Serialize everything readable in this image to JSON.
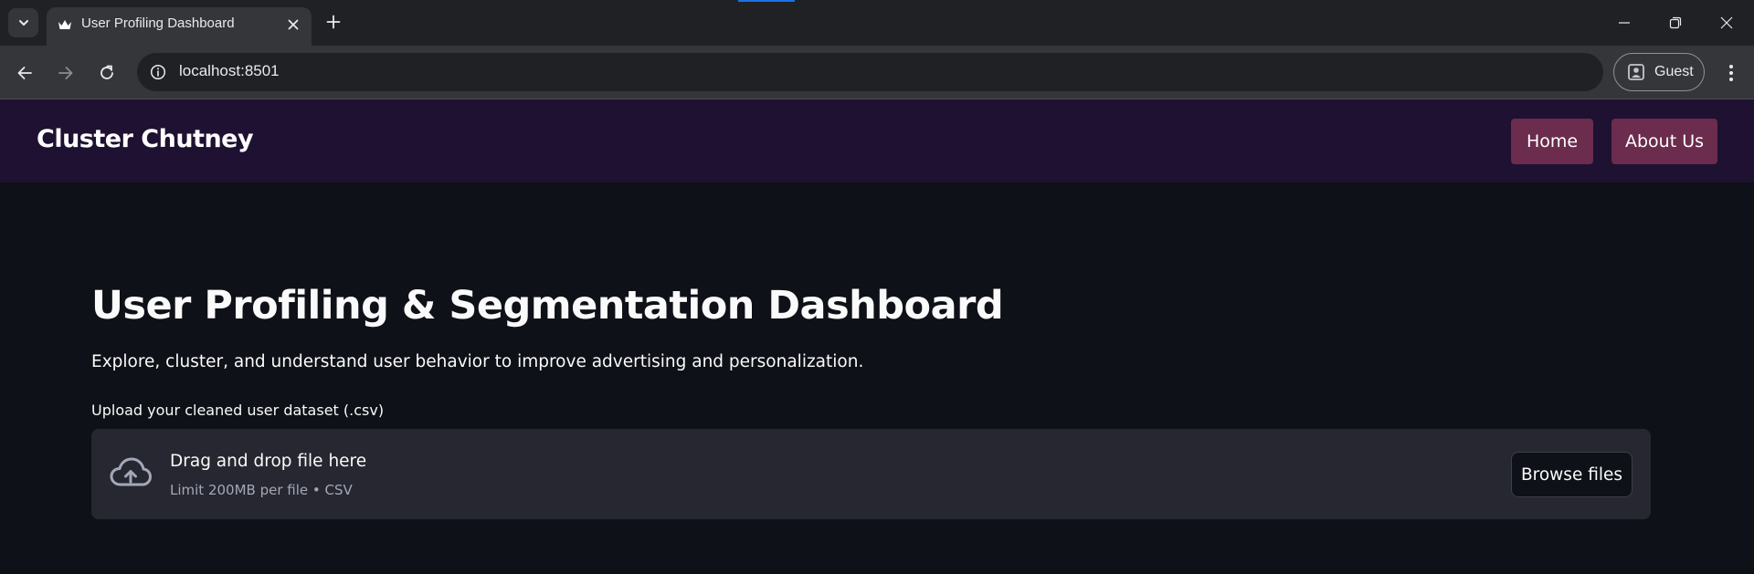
{
  "browser": {
    "tab_title": "User Profiling Dashboard",
    "url": "localhost:8501",
    "profile_label": "Guest"
  },
  "header": {
    "brand": "Cluster Chutney",
    "nav": [
      "Home",
      "About Us"
    ]
  },
  "main": {
    "title": "User Profiling & Segmentation Dashboard",
    "description": "Explore, cluster, and understand user behavior to improve advertising and personalization.",
    "upload_label": "Upload your cleaned user dataset (.csv)",
    "dropzone": {
      "title": "Drag and drop file here",
      "subtitle": "Limit 200MB per file • CSV",
      "button": "Browse files"
    }
  },
  "colors": {
    "header_bg": "#1e1131",
    "nav_button": "#6b2c4d",
    "page_bg": "#0e1117",
    "dropzone_bg": "#262730"
  },
  "icons": [
    "chevron-down-icon",
    "crown-icon",
    "close-icon",
    "plus-icon",
    "minimize-icon",
    "restore-icon",
    "back-icon",
    "forward-icon",
    "reload-icon",
    "info-icon",
    "profile-icon",
    "more-vert-icon",
    "cloud-upload-icon"
  ]
}
